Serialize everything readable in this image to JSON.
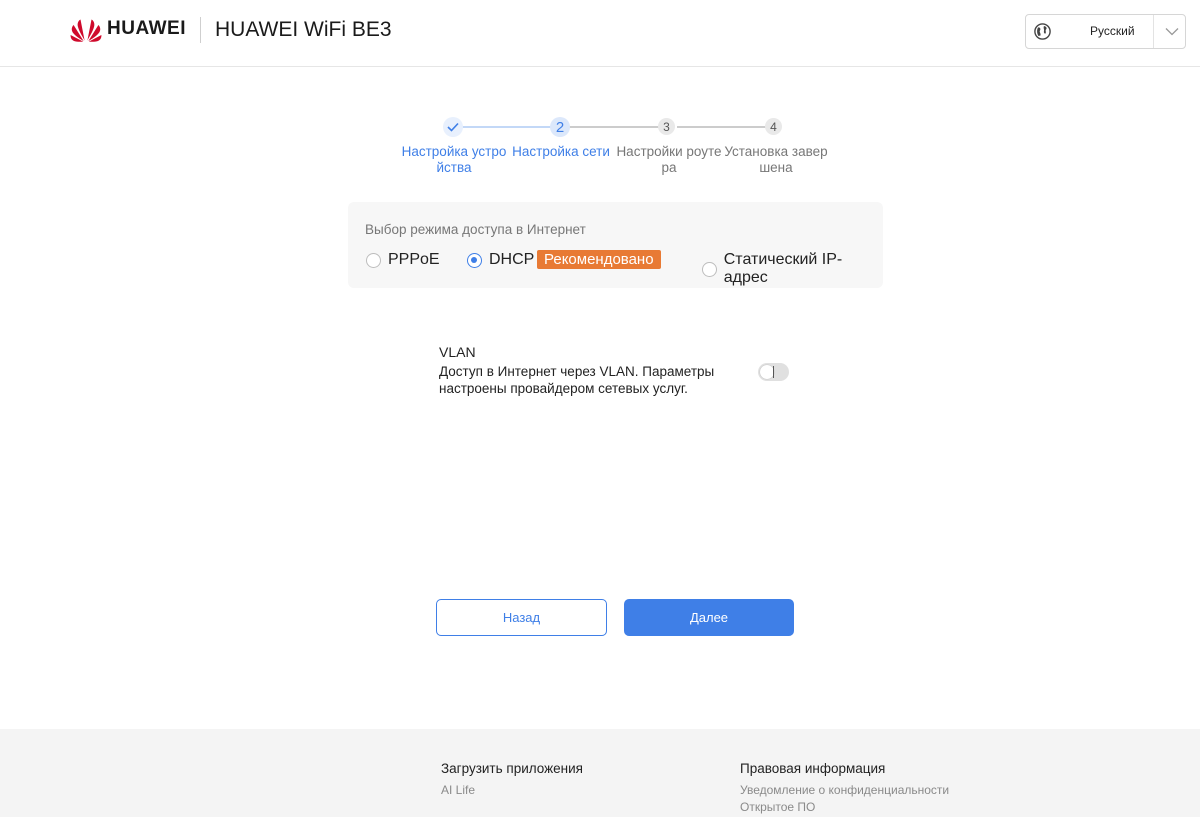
{
  "header": {
    "brand": "HUAWEI",
    "product_title": "HUAWEI WiFi BE3",
    "language": {
      "icon": "globe-icon",
      "selected": "Русский",
      "chevron_icon": "chevron-down-icon"
    }
  },
  "stepper": {
    "steps": [
      {
        "number": "✓",
        "label": "Настройка устройства",
        "state": "done"
      },
      {
        "number": "2",
        "label": "Настройка сети",
        "state": "current"
      },
      {
        "number": "3",
        "label": "Настройки роутера",
        "state": "pending"
      },
      {
        "number": "4",
        "label": "Установка завершена",
        "state": "pending"
      }
    ]
  },
  "access_mode": {
    "title": "Выбор режима доступа в Интернет",
    "options": [
      {
        "label": "PPPoE",
        "selected": false
      },
      {
        "label": "DHCP",
        "selected": true
      },
      {
        "label": "Статический IP-адрес",
        "selected": false
      }
    ],
    "recommended_badge": "Рекомендовано"
  },
  "vlan": {
    "title": "VLAN",
    "description": "Доступ в Интернет через VLAN. Параметры настроены провайдером сетевых услуг.",
    "enabled": false
  },
  "actions": {
    "back": "Назад",
    "next": "Далее"
  },
  "footer": {
    "apps": {
      "heading": "Загрузить приложения",
      "links": [
        "AI Life"
      ]
    },
    "legal": {
      "heading": "Правовая информация",
      "links": [
        "Уведомление о конфиденциальности",
        "Открытое ПО"
      ]
    }
  },
  "colors": {
    "accent": "#3f7fe7",
    "badge": "#e87a34",
    "brand_red": "#cf0a2c"
  }
}
